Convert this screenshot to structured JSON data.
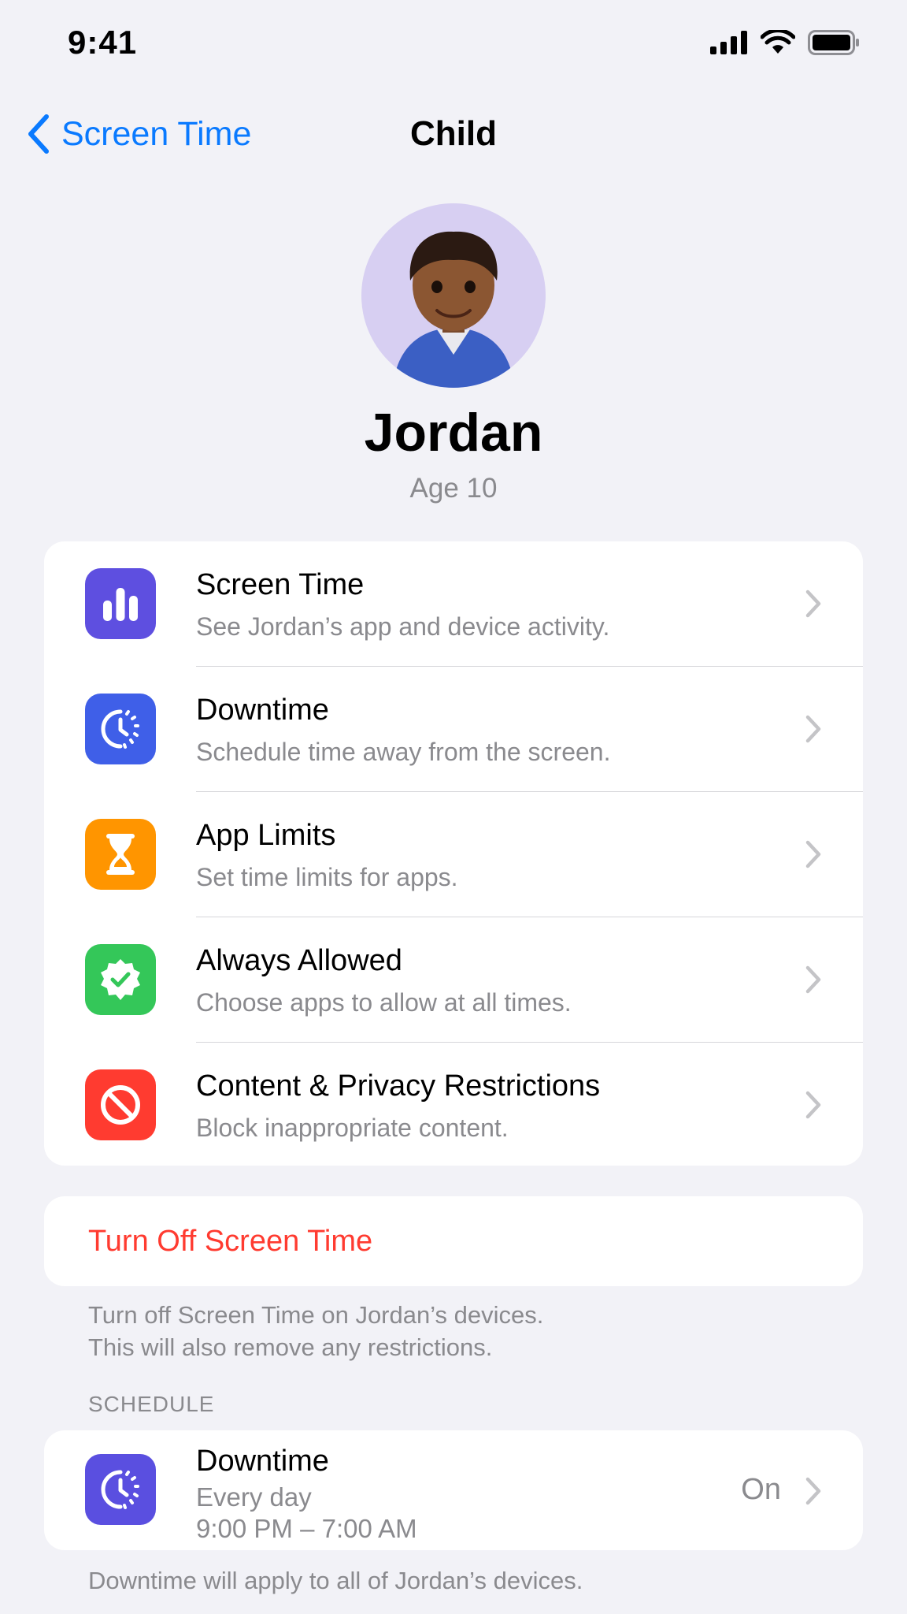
{
  "status_bar": {
    "time": "9:41"
  },
  "nav": {
    "back_label": "Screen Time",
    "title": "Child"
  },
  "profile": {
    "name": "Jordan",
    "age": "Age 10"
  },
  "menu": {
    "items": [
      {
        "title": "Screen Time",
        "subtitle": "See Jordan’s app and device activity.",
        "icon": "bar-chart-icon",
        "color": "#5e4fe0"
      },
      {
        "title": "Downtime",
        "subtitle": "Schedule time away from the screen.",
        "icon": "downtime-clock-icon",
        "color": "#3f5fe8"
      },
      {
        "title": "App Limits",
        "subtitle": "Set time limits for apps.",
        "icon": "hourglass-icon",
        "color": "#ff9500"
      },
      {
        "title": "Always Allowed",
        "subtitle": "Choose apps to allow at all times.",
        "icon": "checkmark-seal-icon",
        "color": "#34c759"
      },
      {
        "title": "Content & Privacy Restrictions",
        "subtitle": "Block inappropriate content.",
        "icon": "prohibited-icon",
        "color": "#ff3b30"
      }
    ]
  },
  "turn_off": {
    "label": "Turn Off Screen Time",
    "footnote_line1": "Turn off Screen Time on Jordan’s devices.",
    "footnote_line2": "This will also remove any restrictions."
  },
  "schedule": {
    "header": "SCHEDULE",
    "title": "Downtime",
    "line1": "Every day",
    "line2": "9:00 PM – 7:00 AM",
    "status": "On",
    "footnote": "Downtime will apply to all of Jordan’s devices."
  },
  "colors": {
    "accent": "#0a7aff",
    "destructive": "#ff3b30",
    "background": "#f2f2f7"
  }
}
